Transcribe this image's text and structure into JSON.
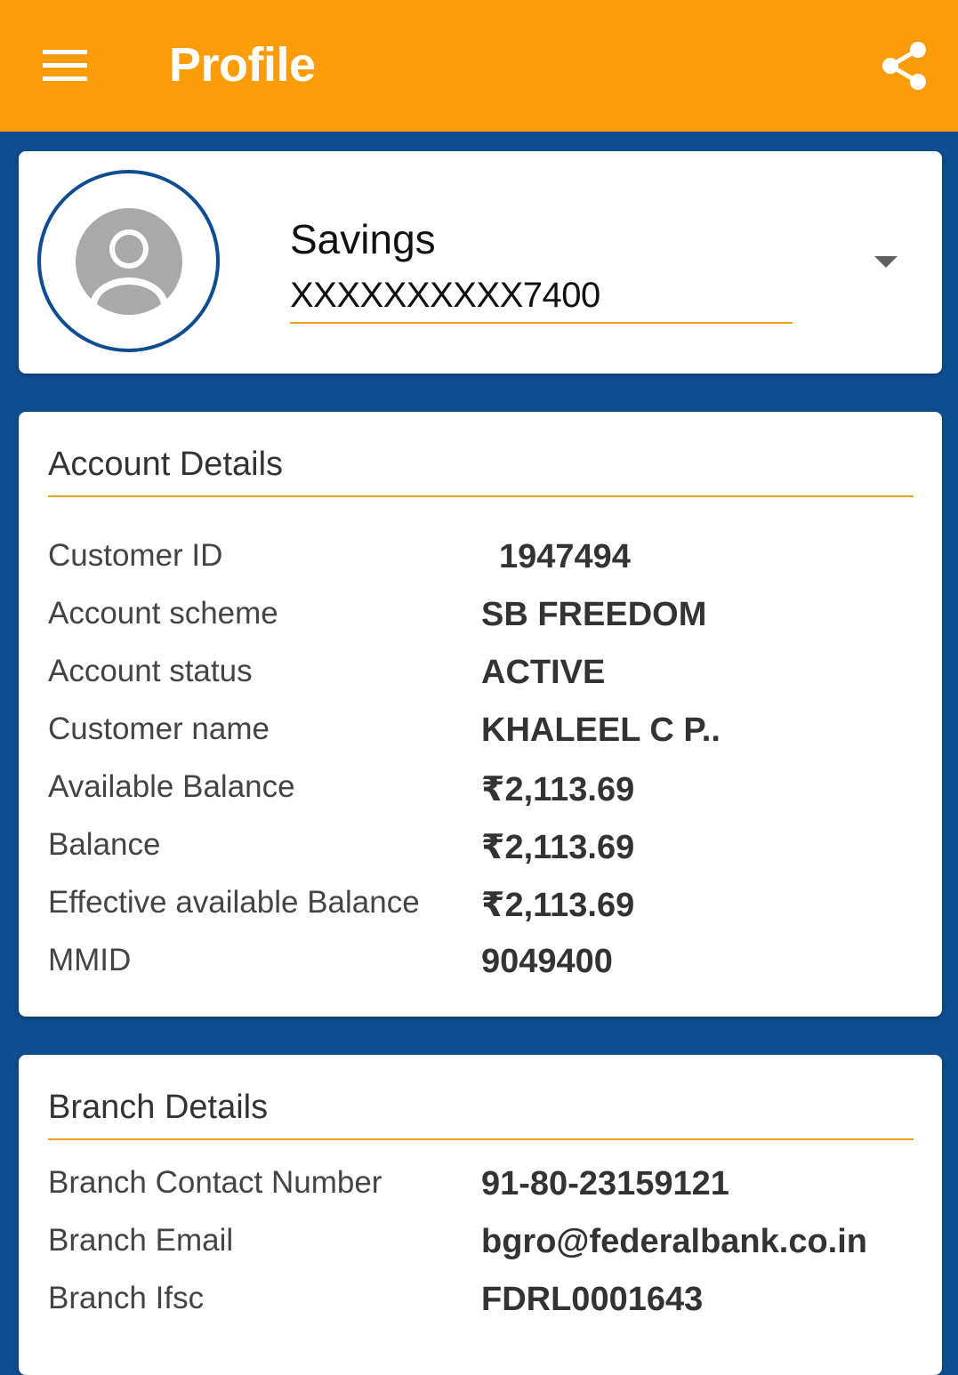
{
  "appbar": {
    "title": "Profile",
    "menu_icon": "hamburger-menu-icon",
    "share_icon": "share-icon",
    "color": "#fb9c0a"
  },
  "account_selector": {
    "avatar_icon": "user-avatar-icon",
    "account_type": "Savings",
    "account_number": "XXXXXXXXXX7400"
  },
  "account_details": {
    "title": "Account Details",
    "rows": [
      {
        "label": "Customer ID",
        "value": "1947494"
      },
      {
        "label": "Account scheme",
        "value": "SB FREEDOM"
      },
      {
        "label": "Account status",
        "value": "ACTIVE"
      },
      {
        "label": "Customer name",
        "value": "KHALEEL C P.."
      },
      {
        "label": "Available Balance",
        "value": "₹2,113.69"
      },
      {
        "label": "Balance",
        "value": "₹2,113.69"
      },
      {
        "label": "Effective available Balance",
        "value": "₹2,113.69"
      },
      {
        "label": "MMID",
        "value": "9049400"
      }
    ]
  },
  "branch_details": {
    "title": "Branch Details",
    "rows": [
      {
        "label": "Branch Contact Number",
        "value": "91-80-23159121"
      },
      {
        "label": "Branch Email",
        "value": "bgro@federalbank.co.in"
      },
      {
        "label": "Branch Ifsc",
        "value": "FDRL0001643"
      }
    ]
  },
  "colors": {
    "background": "#0e4d8f",
    "accent_line": "#e5a316"
  }
}
